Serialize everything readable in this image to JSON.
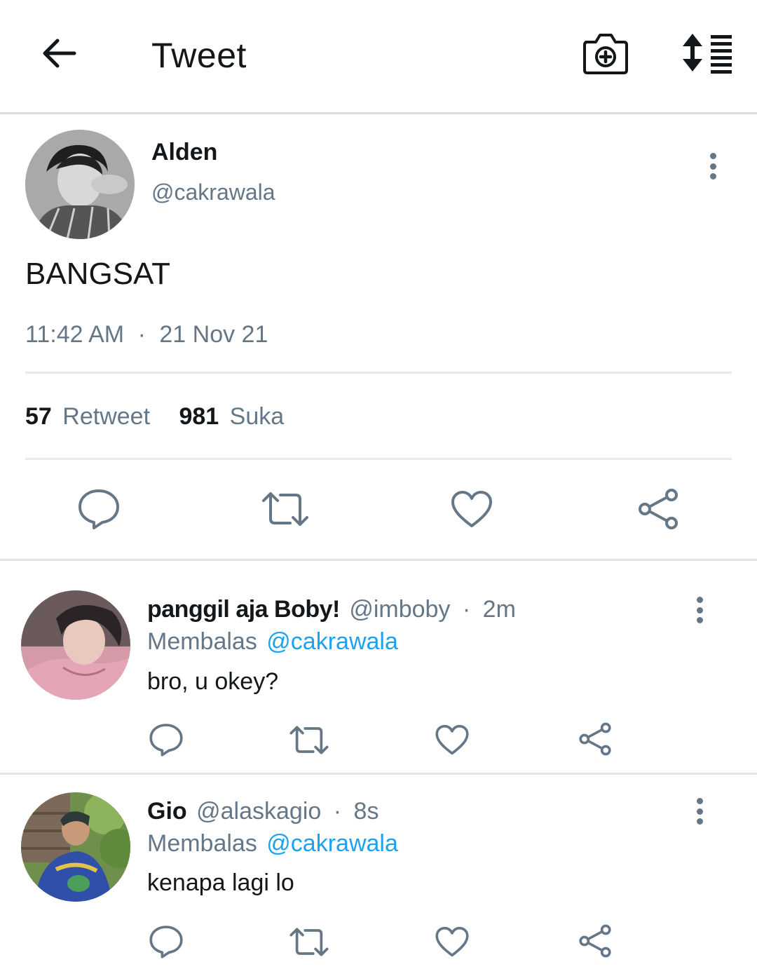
{
  "header": {
    "title": "Tweet"
  },
  "tweet": {
    "name": "Alden",
    "handle": "@cakrawala",
    "text": "BANGSAT",
    "time": "11:42 AM",
    "sep": "·",
    "date": "21 Nov 21",
    "retweet_count": "57",
    "retweet_label": "Retweet",
    "like_count": "981",
    "like_label": "Suka"
  },
  "replies": [
    {
      "name": "panggil aja Boby!",
      "handle": "@imboby",
      "sep": "·",
      "time": "2m",
      "replying_label": "Membalas",
      "replying_to": "@cakrawala",
      "text": "bro, u okey?"
    },
    {
      "name": "Gio",
      "handle": "@alaskagio",
      "sep": "·",
      "time": "8s",
      "replying_label": "Membalas",
      "replying_to": "@cakrawala",
      "text": "kenapa lagi lo"
    }
  ],
  "colors": {
    "accent": "#1da1f2",
    "icon": "#657786",
    "text": "#14171a"
  }
}
